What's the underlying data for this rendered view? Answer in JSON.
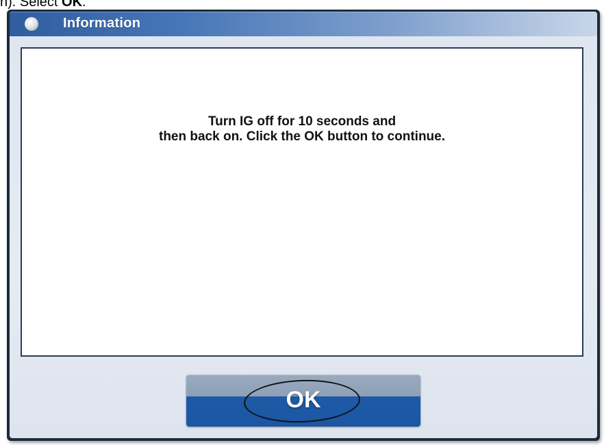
{
  "instruction": {
    "prefix": "n). Select ",
    "emphasis": "OK",
    "suffix": "."
  },
  "dialog": {
    "title": "Information",
    "message_line1": "Turn IG off for 10 seconds and",
    "message_line2": "then back on. Click the OK button to continue.",
    "ok_label": "OK"
  },
  "icons": {
    "title_icon": "info-bullet-icon"
  },
  "colors": {
    "titlebar_start": "#2f5d9e",
    "titlebar_end": "#c9d6e9",
    "button_blue": "#1e5aa6",
    "frame_dark": "#1c2a3c"
  }
}
